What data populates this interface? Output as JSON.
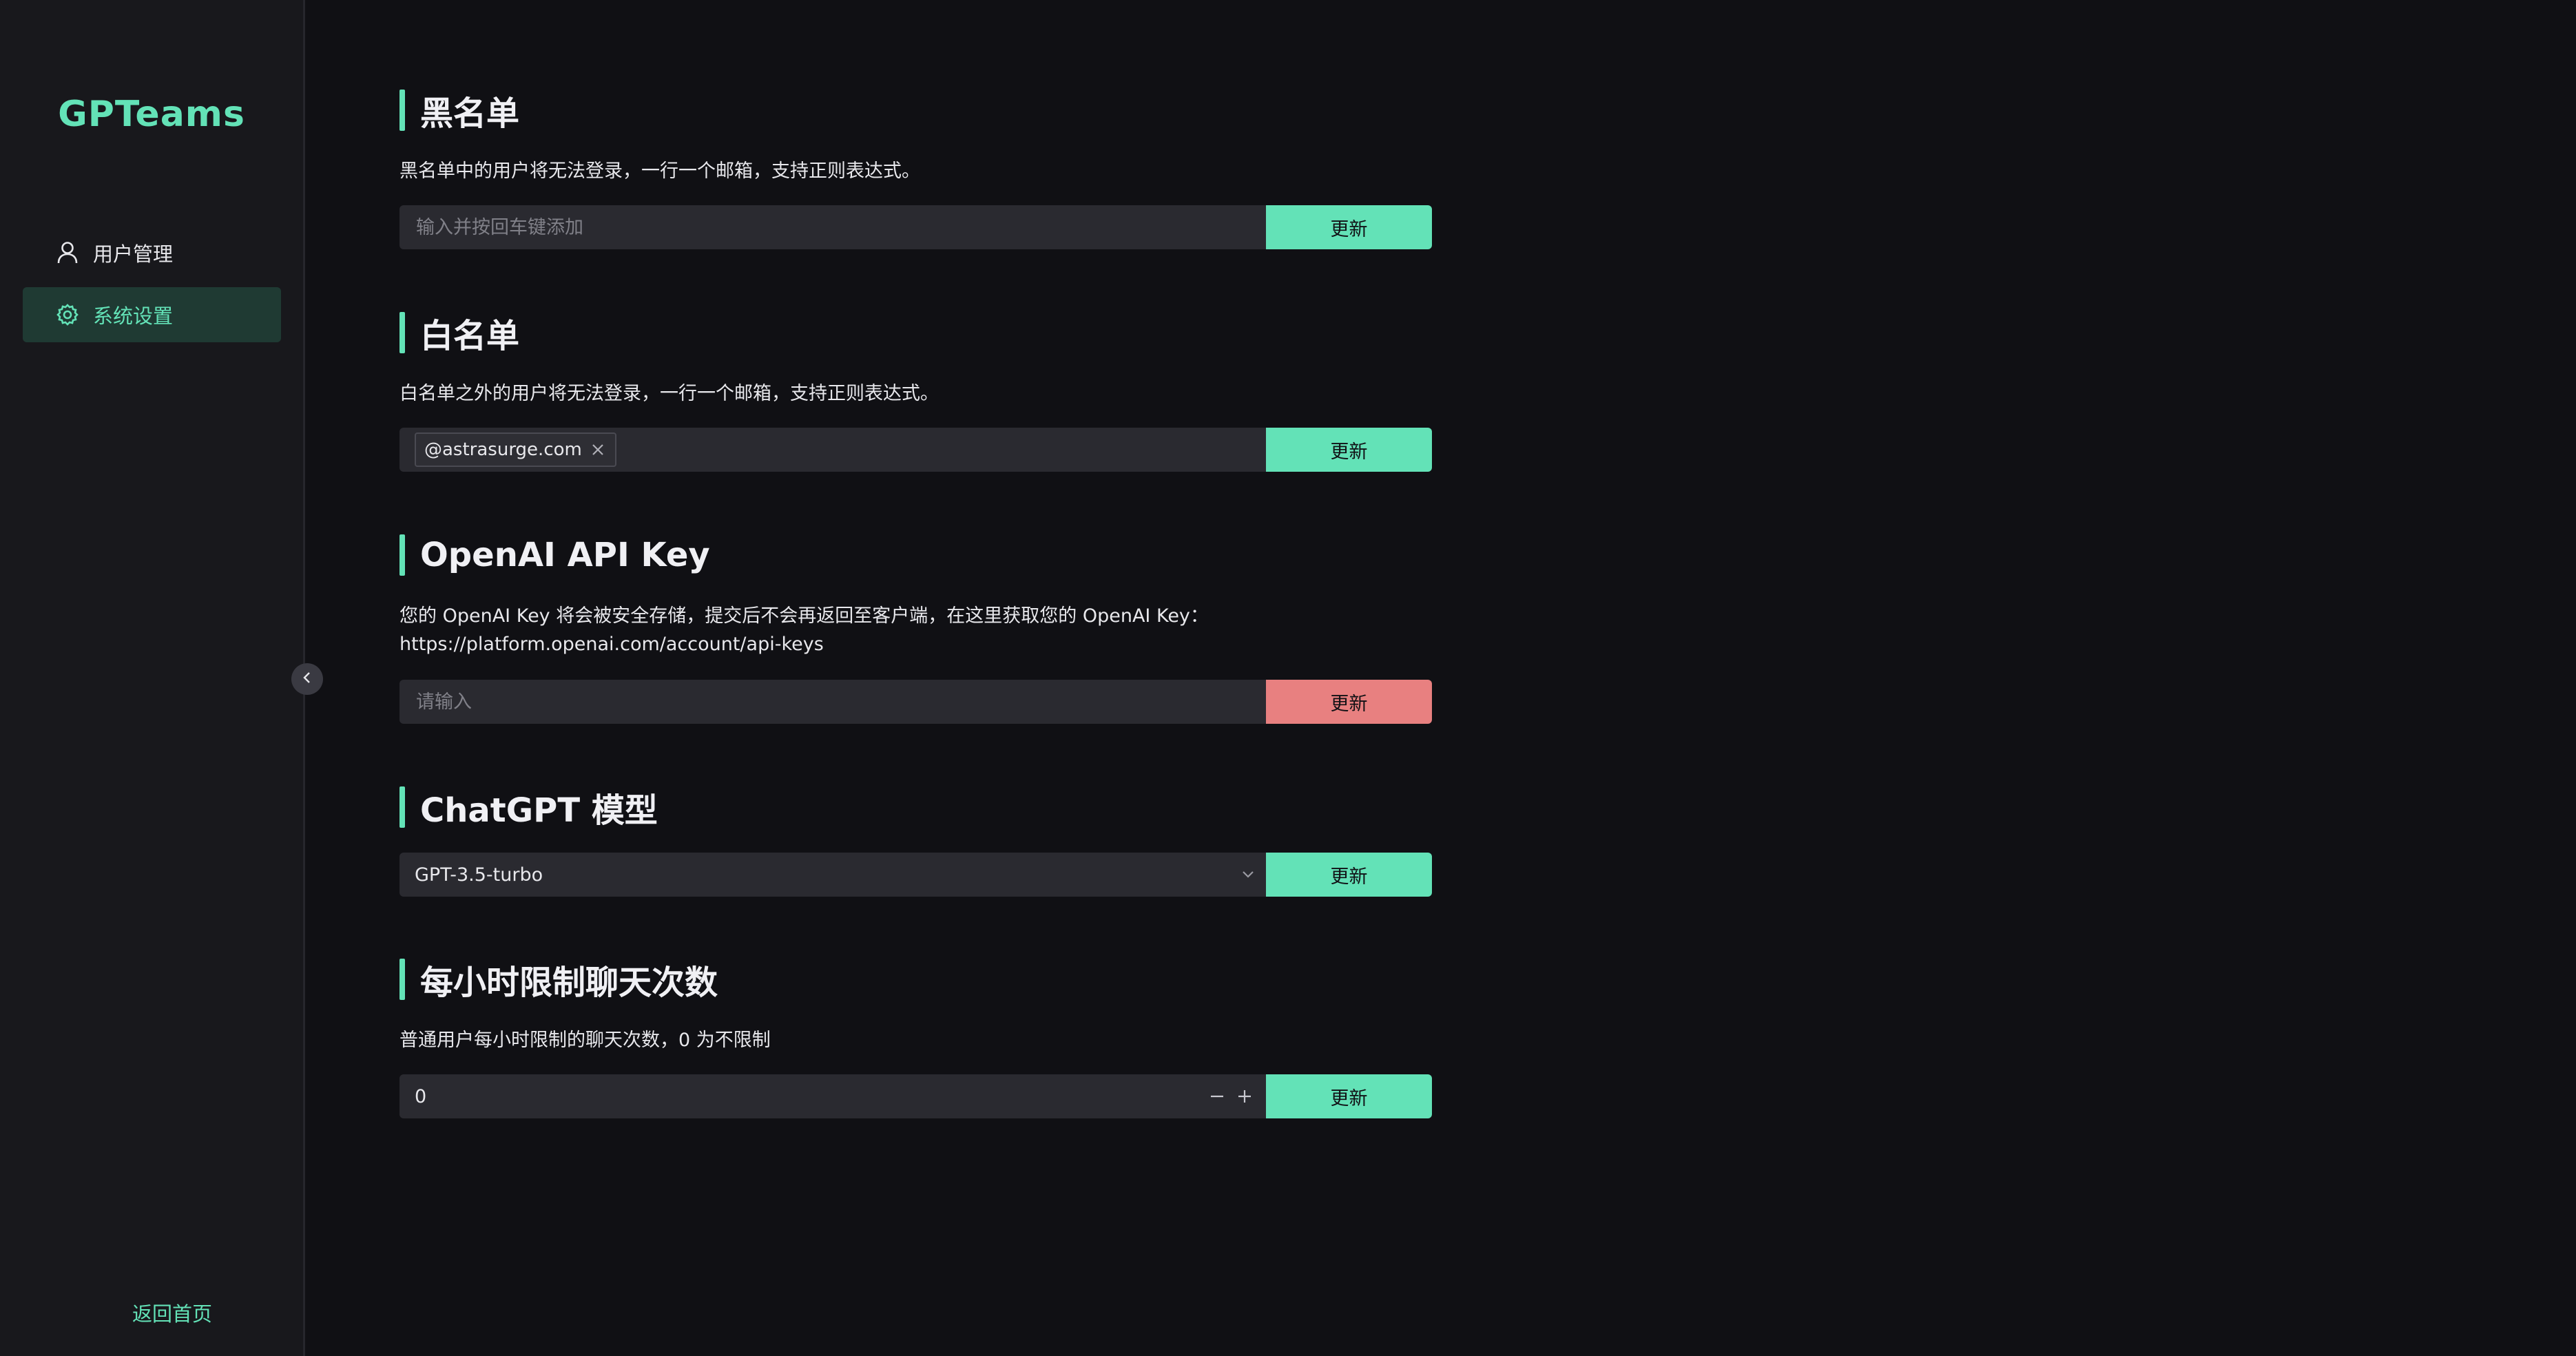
{
  "app": {
    "logo": "GPTeams"
  },
  "sidebar": {
    "items": [
      {
        "label": "用户管理",
        "icon": "user-icon",
        "active": false
      },
      {
        "label": "系统设置",
        "icon": "gear-icon",
        "active": true
      }
    ],
    "back_home": "返回首页"
  },
  "sections": {
    "blacklist": {
      "title": "黑名单",
      "desc": "黑名单中的用户将无法登录，一行一个邮箱，支持正则表达式。",
      "placeholder": "输入并按回车键添加",
      "button": "更新"
    },
    "whitelist": {
      "title": "白名单",
      "desc": "白名单之外的用户将无法登录，一行一个邮箱，支持正则表达式。",
      "tags": [
        "@astrasurge.com"
      ],
      "button": "更新"
    },
    "api_key": {
      "title": "OpenAI API Key",
      "desc_line1": "您的 OpenAI Key 将会被安全存储，提交后不会再返回至客户端，在这里获取您的 OpenAI Key：",
      "desc_line2": "https://platform.openai.com/account/api-keys",
      "placeholder": "请输入",
      "button": "更新"
    },
    "model": {
      "title": "ChatGPT 模型",
      "selected": "GPT-3.5-turbo",
      "button": "更新"
    },
    "rate_limit": {
      "title": "每小时限制聊天次数",
      "desc": "普通用户每小时限制的聊天次数，0 为不限制",
      "value": "0",
      "button": "更新"
    }
  },
  "colors": {
    "accent": "#63e2b7",
    "danger": "#e88080",
    "background": "#101014",
    "sidebar": "#18181c",
    "field": "#2a2a30"
  }
}
